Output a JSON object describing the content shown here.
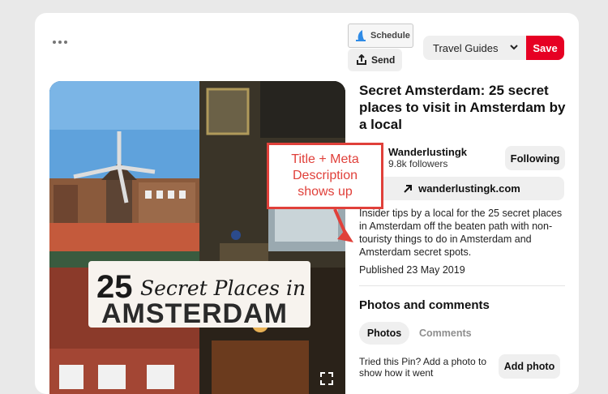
{
  "toolbar": {
    "more_label": "More options",
    "schedule_label": "Schedule",
    "send_label": "Send",
    "board_selected": "Travel Guides",
    "save_label": "Save"
  },
  "pin": {
    "image_text_line1": "25",
    "image_text_script": "Secret Places in",
    "image_text_line2": "AMSTERDAM",
    "title": "Secret Amsterdam: 25 secret places to visit in Amsterdam by a local",
    "author": {
      "name": "Wanderlustingk",
      "followers": "9.8k followers"
    },
    "following_label": "Following",
    "link_label": "wanderlustingk.com",
    "description": "Insider tips by a local for the 25 secret places in Amsterdam off the beaten path with non-touristy things to do in Amsterdam and Amsterdam secret spots.",
    "published": "Published 23 May 2019"
  },
  "comments": {
    "heading": "Photos and comments",
    "tabs": [
      "Photos",
      "Comments"
    ],
    "tried_text": "Tried this Pin? Add a photo to show how it went",
    "add_photo_label": "Add photo"
  },
  "annotation": {
    "callout_text": "Title + Meta\nDescription\nshows up"
  },
  "colors": {
    "save_red": "#e60023",
    "callout_red": "#e0403a"
  },
  "icons": {
    "more": "ellipsis-icon",
    "schedule": "schedule-icon",
    "send": "share-upload-icon",
    "chevron": "chevron-down-icon",
    "link": "arrow-up-right-icon",
    "expand": "expand-icon"
  }
}
